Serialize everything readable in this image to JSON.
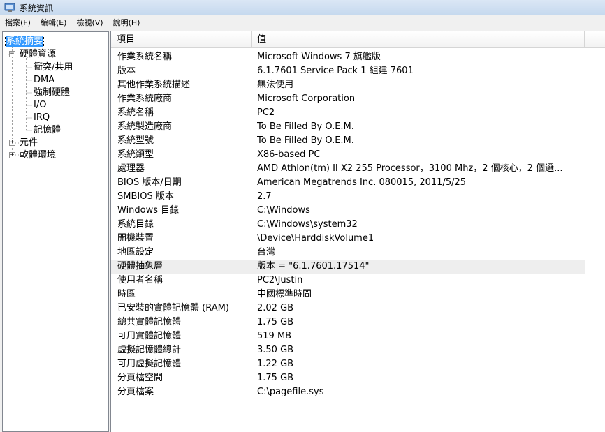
{
  "window": {
    "title": "系統資訊"
  },
  "menu": [
    "檔案(F)",
    "編輯(E)",
    "檢視(V)",
    "說明(H)"
  ],
  "tree": {
    "root": "系統摘要",
    "items": [
      {
        "label": "硬體資源",
        "expanded": true,
        "children": [
          "衝突/共用",
          "DMA",
          "強制硬體",
          "I/O",
          "IRQ",
          "記憶體"
        ]
      },
      {
        "label": "元件",
        "expanded": false
      },
      {
        "label": "軟體環境",
        "expanded": false
      }
    ]
  },
  "columns": {
    "item": "項目",
    "value": "值"
  },
  "rows": [
    {
      "item": "作業系統名稱",
      "value": "Microsoft Windows 7 旗艦版"
    },
    {
      "item": "版本",
      "value": "6.1.7601 Service Pack 1 組建 7601"
    },
    {
      "item": "其他作業系統描述",
      "value": "無法使用"
    },
    {
      "item": "作業系統廠商",
      "value": "Microsoft Corporation"
    },
    {
      "item": "系統名稱",
      "value": "PC2"
    },
    {
      "item": "系統製造廠商",
      "value": "To Be Filled By O.E.M."
    },
    {
      "item": "系統型號",
      "value": "To Be Filled By O.E.M."
    },
    {
      "item": "系統類型",
      "value": "X86-based PC"
    },
    {
      "item": "處理器",
      "value": "AMD Athlon(tm) II X2 255 Processor，3100 Mhz，2 個核心，2 個邏..."
    },
    {
      "item": "BIOS 版本/日期",
      "value": "American Megatrends Inc. 080015, 2011/5/25"
    },
    {
      "item": "SMBIOS 版本",
      "value": "2.7"
    },
    {
      "item": "Windows 目錄",
      "value": "C:\\Windows"
    },
    {
      "item": "系統目錄",
      "value": "C:\\Windows\\system32"
    },
    {
      "item": "開機裝置",
      "value": "\\Device\\HarddiskVolume1"
    },
    {
      "item": "地區設定",
      "value": "台灣"
    },
    {
      "item": "硬體抽象層",
      "value": "版本 = \"6.1.7601.17514\""
    },
    {
      "item": "使用者名稱",
      "value": "PC2\\Justin"
    },
    {
      "item": "時區",
      "value": "中國標準時間"
    },
    {
      "item": "已安裝的實體記憶體 (RAM)",
      "value": "2.02 GB"
    },
    {
      "item": "總共實體記憶體",
      "value": "1.75 GB"
    },
    {
      "item": "可用實體記憶體",
      "value": "519 MB"
    },
    {
      "item": "虛擬記憶體總計",
      "value": "3.50 GB"
    },
    {
      "item": "可用虛擬記憶體",
      "value": "1.22 GB"
    },
    {
      "item": "分頁檔空間",
      "value": "1.75 GB"
    },
    {
      "item": "分頁檔案",
      "value": "C:\\pagefile.sys"
    }
  ],
  "highlighted_row_index": 15,
  "colors": {
    "selection": "#3399ff",
    "row_highlight": "#eeeeee"
  }
}
